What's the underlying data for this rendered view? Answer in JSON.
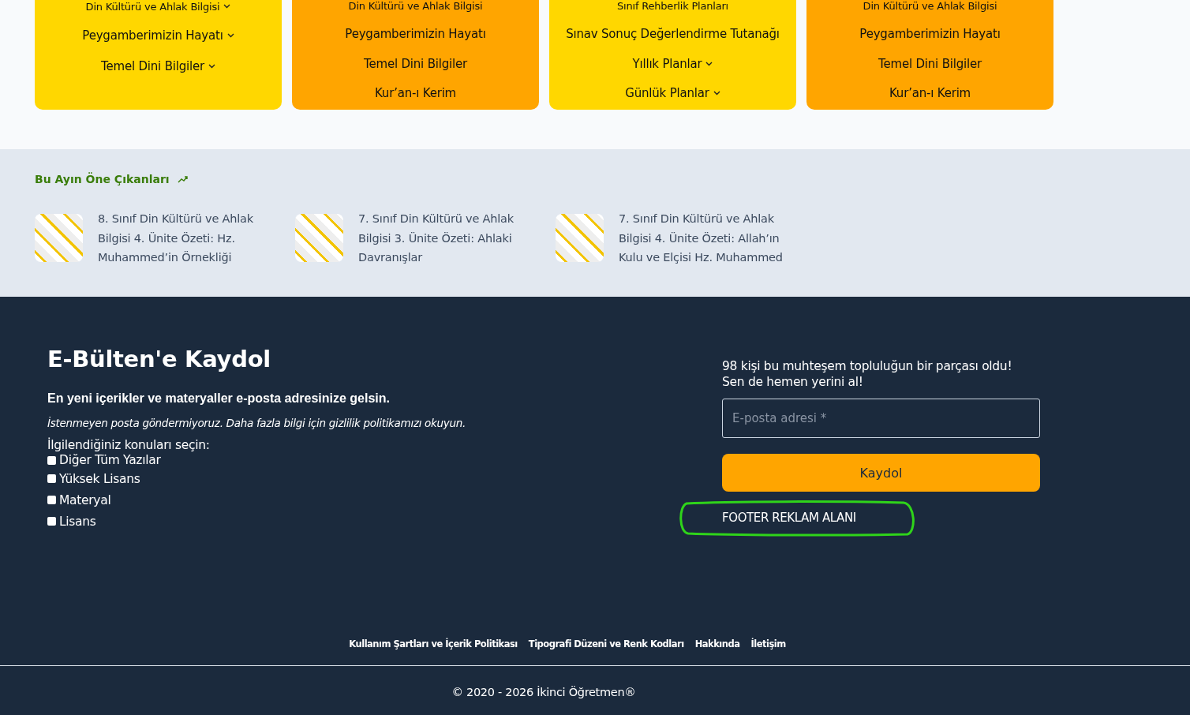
{
  "menu_cards": [
    {
      "color": "#ffd700",
      "items": [
        {
          "label": "Din Kültürü ve Ahlak Bilgisi",
          "has_submenu": true
        },
        {
          "label": "Peygamberimizin Hayatı",
          "has_submenu": true
        },
        {
          "label": "Temel Dini Bilgiler",
          "has_submenu": true
        }
      ]
    },
    {
      "color": "#ffa500",
      "items": [
        {
          "label": "Din Kültürü ve Ahlak Bilgisi",
          "has_submenu": false
        },
        {
          "label": "Peygamberimizin Hayatı",
          "has_submenu": false
        },
        {
          "label": "Temel Dini Bilgiler",
          "has_submenu": false
        },
        {
          "label": "Kur’an-ı Kerim",
          "has_submenu": false
        }
      ]
    },
    {
      "color": "#ffd700",
      "items": [
        {
          "label": "Sınıf Rehberlik Planları",
          "has_submenu": false
        },
        {
          "label": "Sınav Sonuç Değerlendirme Tutanağı",
          "has_submenu": false
        },
        {
          "label": "Yıllık Planlar",
          "has_submenu": true
        },
        {
          "label": "Günlük Planlar",
          "has_submenu": true
        }
      ]
    },
    {
      "color": "#ffa500",
      "items": [
        {
          "label": "Din Kültürü ve Ahlak Bilgisi",
          "has_submenu": false
        },
        {
          "label": "Peygamberimizin Hayatı",
          "has_submenu": false
        },
        {
          "label": "Temel Dini Bilgiler",
          "has_submenu": false
        },
        {
          "label": "Kur’an-ı Kerim",
          "has_submenu": false
        }
      ]
    }
  ],
  "featured": {
    "title": "Bu Ayın Öne Çıkanları",
    "posts": [
      {
        "title": "8. Sınıf Din Kültürü ve Ahlak Bilgisi 4. Ünite Özeti: Hz. Muhammed’in Örnekliği"
      },
      {
        "title": "7. Sınıf Din Kültürü ve Ahlak Bilgisi 3. Ünite Özeti: Ahlaki Davranışlar"
      },
      {
        "title": "7. Sınıf Din Kültürü ve Ahlak Bilgisi 4. Ünite Özeti: Allah’ın Kulu ve Elçisi Hz. Muhammed"
      }
    ]
  },
  "newsletter": {
    "title": "E-Bülten'e Kaydol",
    "subtitle": "En yeni içerikler ve materyaller e-posta adresinize gelsin.",
    "notice": "İstenmeyen posta göndermiyoruz. Daha fazla bilgi için gizlilik politikamızı okuyun.",
    "topics_label": "İlgilendiğiniz konuları seçin:",
    "topics": [
      {
        "label": "Diğer Tüm Yazılar",
        "checked": false
      },
      {
        "label": "Yüksek Lisans",
        "checked": false
      },
      {
        "label": "Materyal",
        "checked": false
      },
      {
        "label": "Lisans",
        "checked": false
      }
    ],
    "community_text": "98 kişi bu muhteşem topluluğun bir parçası oldu!",
    "community_cta": "Sen de hemen yerini al!",
    "email": {
      "placeholder": "E-posta adresi *"
    },
    "submit": "Kaydol",
    "ad_label": "FOOTER REKLAM ALANI",
    "ad_circled": true
  },
  "footer": {
    "links": [
      "Kullanım Şartları ve İçerik Politikası",
      "Tipografi Düzeni ve Renk Kodları",
      "Hakkında",
      "İletişim"
    ],
    "copyright": "© 2020 - 2026 İkinci Öğretmen®"
  }
}
